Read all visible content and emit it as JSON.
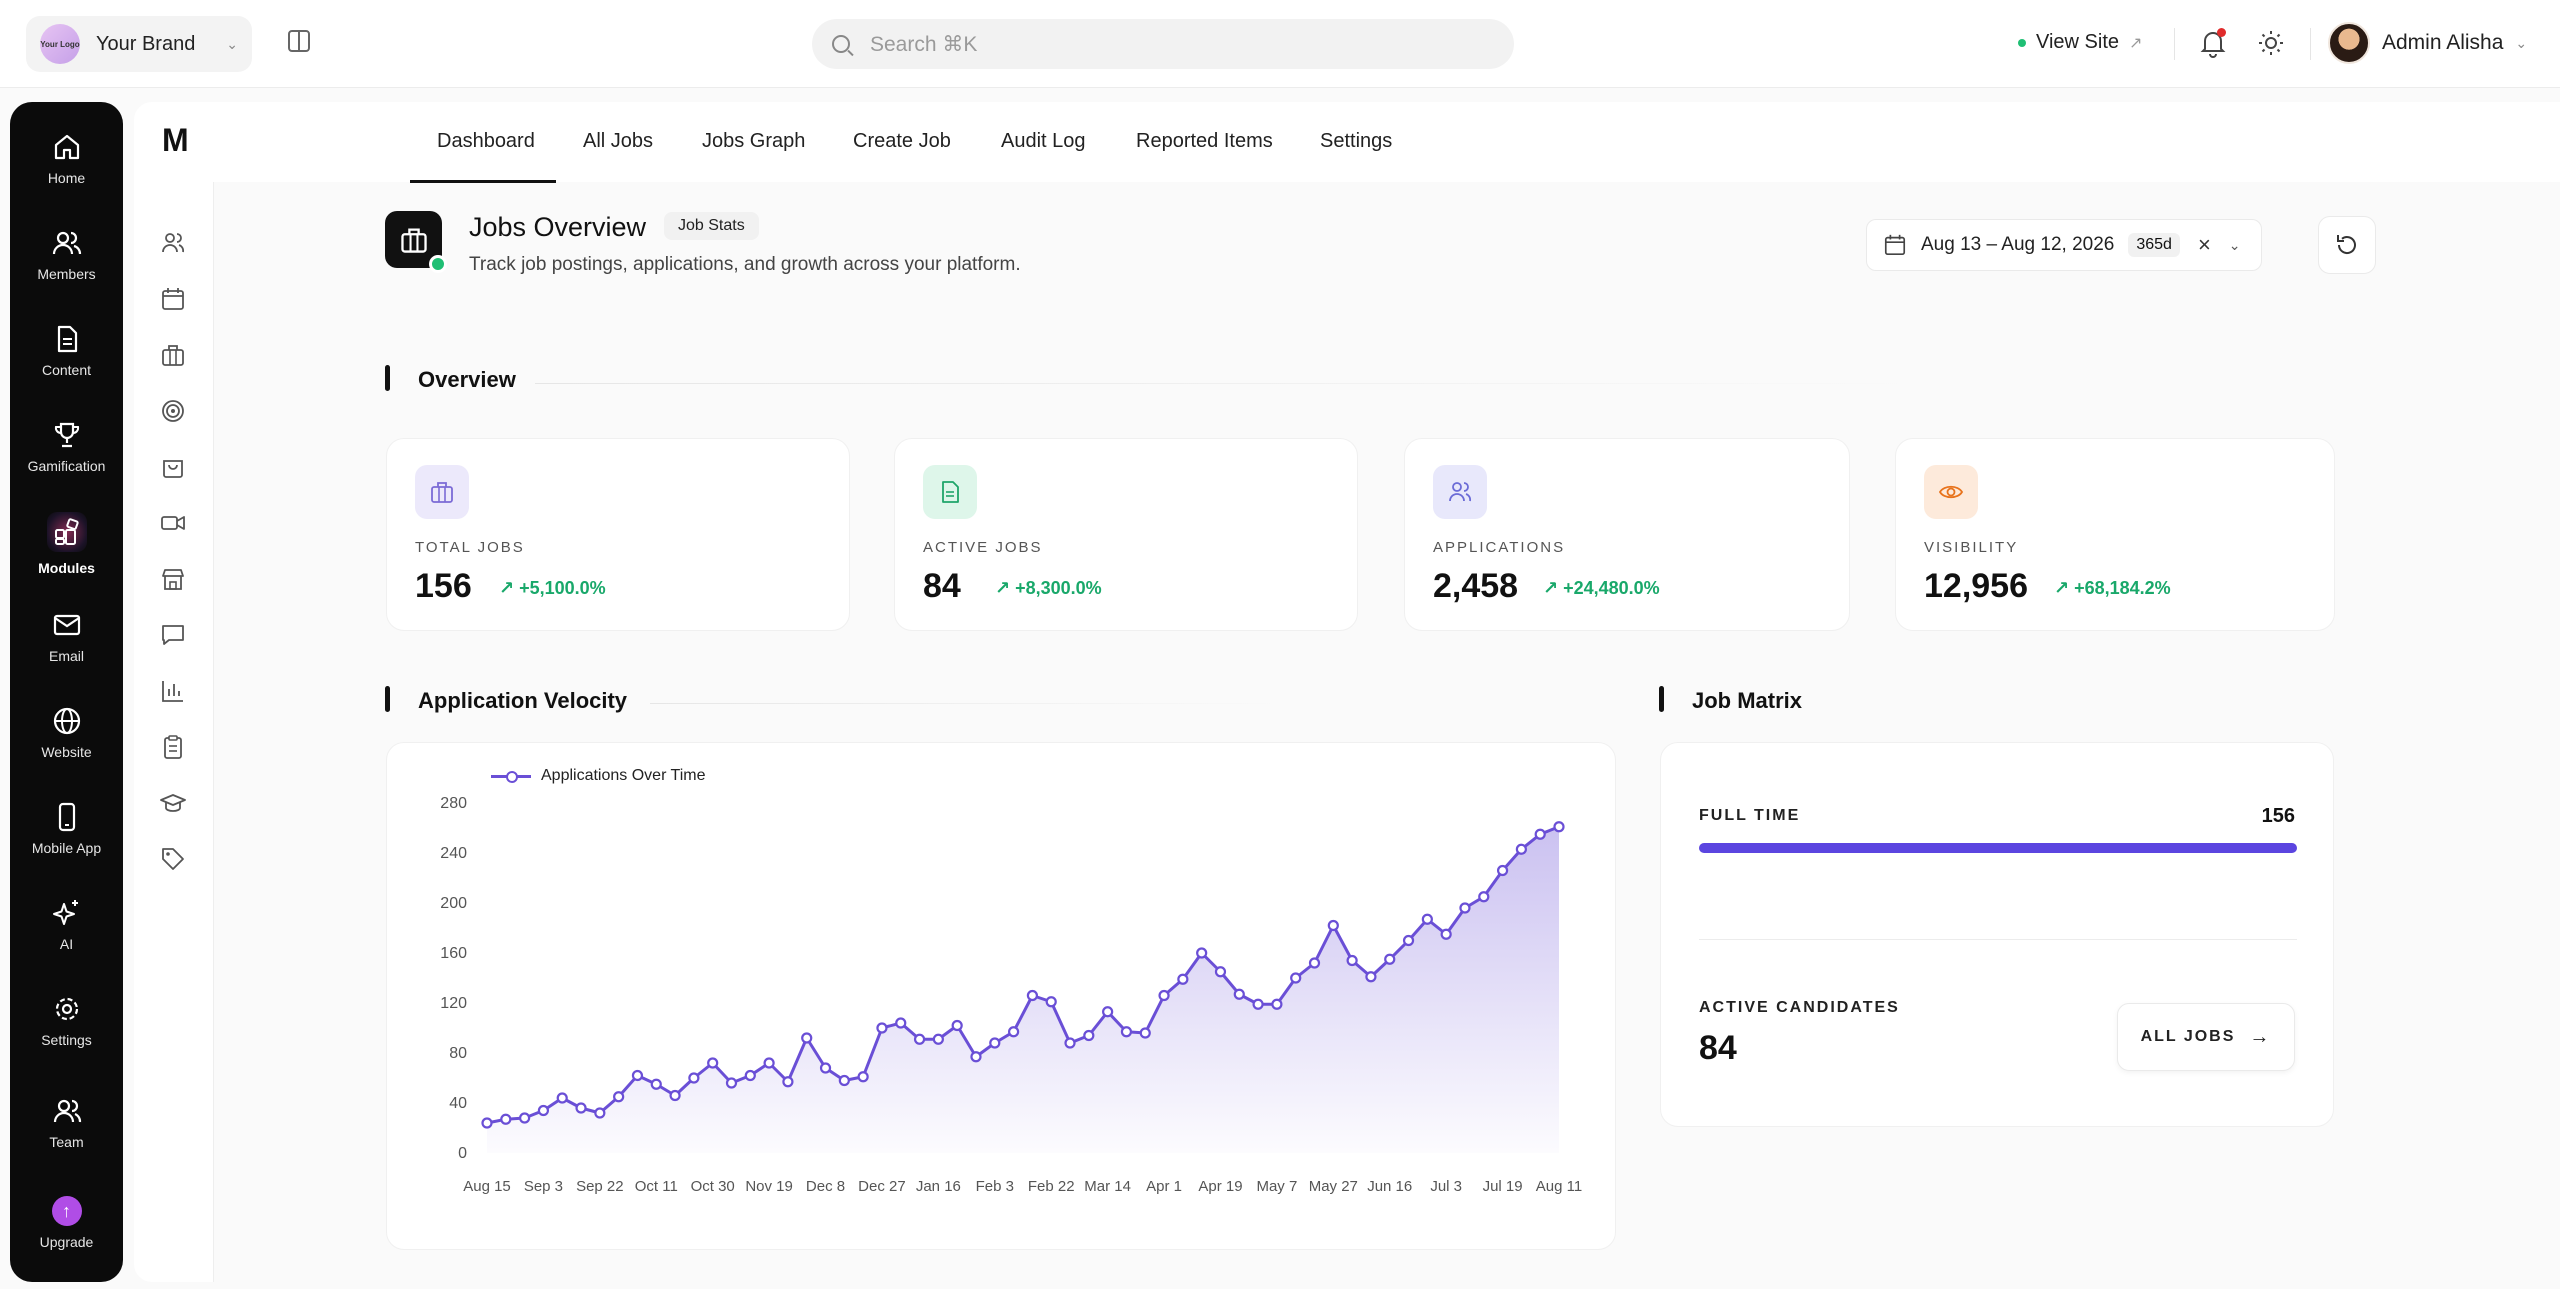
{
  "topbar": {
    "brand_logo_text": "Your Logo",
    "brand_name": "Your Brand",
    "search_placeholder": "Search ⌘K",
    "view_site": "View Site",
    "user_name": "Admin Alisha"
  },
  "sidebar": {
    "items": [
      {
        "label": "Home",
        "icon": "home-icon"
      },
      {
        "label": "Members",
        "icon": "members-icon"
      },
      {
        "label": "Content",
        "icon": "content-icon"
      },
      {
        "label": "Gamification",
        "icon": "trophy-icon"
      },
      {
        "label": "Modules",
        "icon": "modules-icon"
      },
      {
        "label": "Email",
        "icon": "email-icon"
      },
      {
        "label": "Website",
        "icon": "globe-icon"
      },
      {
        "label": "Mobile App",
        "icon": "mobile-icon"
      },
      {
        "label": "AI",
        "icon": "sparkle-icon"
      },
      {
        "label": "Settings",
        "icon": "gear-icon"
      },
      {
        "label": "Team",
        "icon": "team-icon"
      },
      {
        "label": "Upgrade",
        "icon": "upgrade-icon"
      }
    ],
    "active": "Modules"
  },
  "rail": {
    "logo": "M",
    "icons": [
      "users-icon",
      "calendar-icon",
      "briefcase-icon",
      "target-icon",
      "shopping-bag-icon",
      "video-icon",
      "store-icon",
      "chat-icon",
      "bar-chart-icon",
      "clipboard-icon",
      "graduation-cap-icon",
      "tag-icon"
    ]
  },
  "tabs": [
    "Dashboard",
    "All Jobs",
    "Jobs Graph",
    "Create Job",
    "Audit Log",
    "Reported Items",
    "Settings"
  ],
  "header": {
    "title": "Jobs Overview",
    "badge": "Job Stats",
    "subtitle": "Track job postings, applications, and growth across your platform.",
    "date_range": "Aug 13 – Aug 12, 2026",
    "days": "365d"
  },
  "overview": {
    "title": "Overview",
    "stats": [
      {
        "label": "TOTAL JOBS",
        "value": "156",
        "delta": "+5,100.0%",
        "icon": "briefcase-icon",
        "color": "#7b6bd6",
        "bg": "#ece9fb"
      },
      {
        "label": "ACTIVE JOBS",
        "value": "84",
        "delta": "+8,300.0%",
        "icon": "document-icon",
        "color": "#1fa56a",
        "bg": "#def6ea"
      },
      {
        "label": "APPLICATIONS",
        "value": "2,458",
        "delta": "+24,480.0%",
        "icon": "users-icon",
        "color": "#6b6bd6",
        "bg": "#e8e8fb"
      },
      {
        "label": "VISIBILITY",
        "value": "12,956",
        "delta": "+68,184.2%",
        "icon": "eye-icon",
        "color": "#e8731c",
        "bg": "#fdeadb"
      }
    ]
  },
  "velocity": {
    "title": "Application Velocity"
  },
  "chart_data": {
    "type": "area",
    "title": "",
    "series": [
      {
        "name": "Applications Over Time",
        "color": "#6a4fd6",
        "values": [
          24,
          27,
          28,
          34,
          44,
          36,
          32,
          45,
          62,
          55,
          46,
          60,
          72,
          56,
          62,
          72,
          57,
          92,
          68,
          58,
          61,
          100,
          104,
          91,
          91,
          102,
          77,
          88,
          97,
          126,
          121,
          88,
          94,
          113,
          97,
          96,
          126,
          139,
          160,
          145,
          127,
          119,
          119,
          140,
          152,
          182,
          154,
          141,
          155,
          170,
          187,
          175,
          196,
          205,
          226,
          243,
          255,
          261
        ]
      }
    ],
    "x_tick_labels": [
      "Aug 15",
      "Sep 3",
      "Sep 22",
      "Oct 11",
      "Oct 30",
      "Nov 19",
      "Dec 8",
      "Dec 27",
      "Jan 16",
      "Feb 3",
      "Feb 22",
      "Mar 14",
      "Apr 1",
      "Apr 19",
      "May 7",
      "May 27",
      "Jun 16",
      "Jul 3",
      "Jul 19",
      "Aug 11"
    ],
    "y_ticks": [
      0,
      40,
      80,
      120,
      160,
      200,
      240,
      280
    ],
    "ylim": [
      0,
      280
    ],
    "legend": "top-left",
    "grid": false
  },
  "matrix": {
    "title": "Job Matrix",
    "full_time_label": "FULL TIME",
    "full_time_value": "156",
    "full_time_fraction": 1.0,
    "active_candidates_label": "ACTIVE CANDIDATES",
    "active_candidates_value": "84",
    "all_jobs_label": "ALL JOBS"
  }
}
